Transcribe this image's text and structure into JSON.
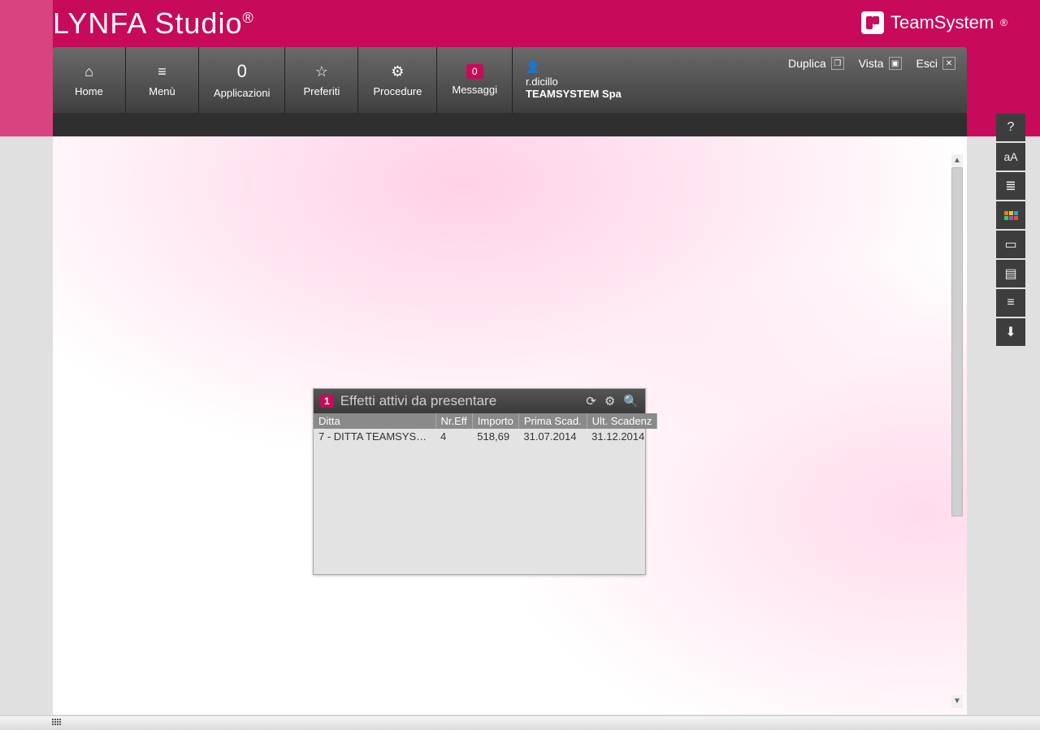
{
  "app": {
    "title": "LYNFA Studio",
    "registered": "®"
  },
  "brand": {
    "name": "TeamSystem",
    "registered": "®"
  },
  "nav": {
    "items": [
      {
        "label": "Home"
      },
      {
        "label": "Menù"
      },
      {
        "label": "Applicazioni",
        "count": "0"
      },
      {
        "label": "Preferiti"
      },
      {
        "label": "Procedure"
      },
      {
        "label": "Messaggi",
        "badge": "0"
      }
    ],
    "user": {
      "name": "r.dicillo",
      "company": "TEAMSYSTEM Spa"
    },
    "right": {
      "duplica": "Duplica",
      "vista": "Vista",
      "esci": "Esci"
    }
  },
  "widget": {
    "badge": "1",
    "title": "Effetti attivi da presentare",
    "columns": {
      "ditta": "Ditta",
      "nreff": "Nr.Eff",
      "importo": "Importo",
      "prima": "Prima Scad.",
      "ult": "Ult. Scadenz"
    },
    "rows": [
      {
        "ditta": "7 - DITTA TEAMSYST…",
        "nreff": "4",
        "importo": "518,69",
        "prima": "31.07.2014",
        "ult": "31.12.2014"
      }
    ]
  },
  "side": {
    "help": "?",
    "textsize": "aA",
    "list1": "≣",
    "layout": "▭",
    "layout2": "▤",
    "align": "≡",
    "download": "⬇"
  }
}
